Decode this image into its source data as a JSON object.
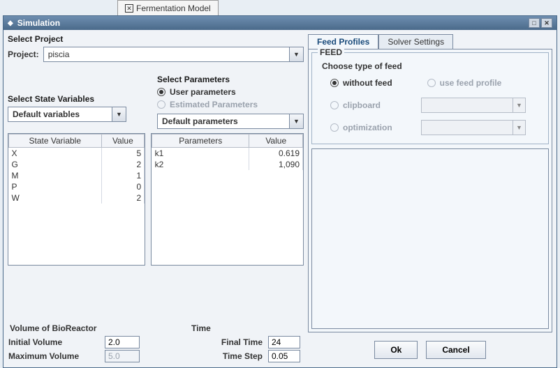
{
  "outer_tab": {
    "label": "Fermentation Model"
  },
  "dialog": {
    "title": "Simulation"
  },
  "left": {
    "project_section": "Select Project",
    "project_label": "Project:",
    "project_value": "piscia",
    "state_vars_section": "Select State Variables",
    "state_vars_value": "Default variables",
    "params_section": "Select Parameters",
    "params_radio_user": "User parameters",
    "params_radio_est": "Estimated Parameters",
    "params_value": "Default parameters",
    "sv_headers": [
      "State Variable",
      "Value"
    ],
    "sv_rows": [
      {
        "n": "X",
        "v": "5"
      },
      {
        "n": "G",
        "v": "2"
      },
      {
        "n": "M",
        "v": "1"
      },
      {
        "n": "P",
        "v": "0"
      },
      {
        "n": "W",
        "v": "2"
      }
    ],
    "pm_headers": [
      "Parameters",
      "Value"
    ],
    "pm_rows": [
      {
        "n": "k1",
        "v": "0.619"
      },
      {
        "n": "k2",
        "v": "1,090"
      }
    ],
    "vol": {
      "legend": "Volume of BioReactor",
      "init_label": "Initial Volume",
      "init_value": "2.0",
      "max_label": "Maximum Volume",
      "max_value": "5.0"
    },
    "time": {
      "legend": "Time",
      "final_label": "Final Time",
      "final_value": "24",
      "step_label": "Time Step",
      "step_value": "0.05"
    }
  },
  "right": {
    "tabs": {
      "feed": "Feed Profiles",
      "solver": "Solver Settings"
    },
    "feed": {
      "legend": "FEED",
      "choose": "Choose type of feed",
      "r_without": "without feed",
      "r_profile": "use feed profile",
      "r_clip": "clipboard",
      "r_opt": "optimization"
    },
    "buttons": {
      "ok": "Ok",
      "cancel": "Cancel"
    }
  }
}
